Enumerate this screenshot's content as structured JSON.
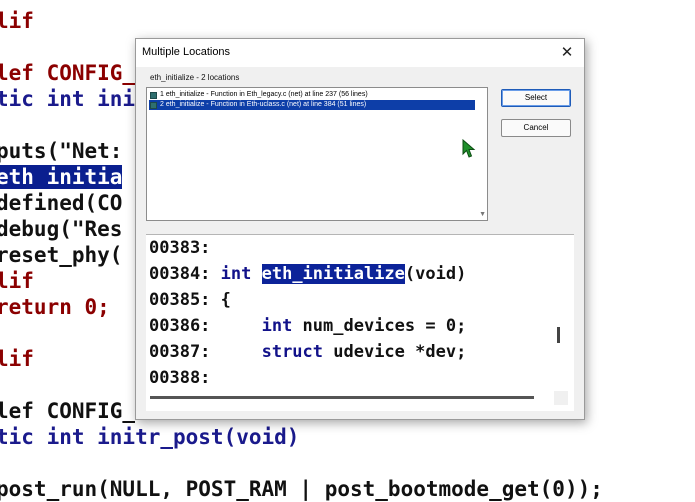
{
  "background_code": [
    {
      "segments": [
        {
          "t": "lif",
          "c": "kw-pre"
        }
      ]
    },
    {
      "segments": []
    },
    {
      "segments": [
        {
          "t": "lef CONFIG_",
          "c": "kw-pre"
        }
      ]
    },
    {
      "segments": [
        {
          "t": "tic int ini",
          "c": "kw-type"
        }
      ]
    },
    {
      "segments": []
    },
    {
      "segments": [
        {
          "t": "puts(\"Net:",
          "c": "plain"
        }
      ]
    },
    {
      "segments": [
        {
          "t": "eth initia",
          "c": "sel"
        }
      ]
    },
    {
      "segments": [
        {
          "t": "defined(CO",
          "c": "plain"
        }
      ]
    },
    {
      "segments": [
        {
          "t": "debug(\"Res",
          "c": "plain"
        }
      ]
    },
    {
      "segments": [
        {
          "t": "reset_phy(",
          "c": "plain"
        }
      ]
    },
    {
      "segments": [
        {
          "t": "lif",
          "c": "kw-pre"
        }
      ]
    },
    {
      "segments": [
        {
          "t": "return 0;",
          "c": "kw-pre"
        }
      ]
    },
    {
      "segments": []
    },
    {
      "segments": [
        {
          "t": "lif",
          "c": "kw-pre"
        }
      ]
    },
    {
      "segments": []
    },
    {
      "segments": [
        {
          "t": "lef CONFIG_",
          "c": "plain"
        }
      ]
    },
    {
      "segments": [
        {
          "t": "tic int initr_post(void)",
          "c": "kw-type"
        }
      ]
    },
    {
      "segments": []
    },
    {
      "segments": [
        {
          "t": "post_run(NULL, POST_RAM | post_bootmode_get(0));",
          "c": "plain"
        }
      ]
    }
  ],
  "dialog": {
    "title": "Multiple Locations",
    "subtitle": "eth_initialize - 2 locations",
    "items": [
      {
        "label": "1 eth_initialize - Function in Eth_legacy.c (net) at line 237 (56 lines)",
        "selected": false
      },
      {
        "label": "2 eth_initialize - Function in Eth-uclass.c (net) at line 384 (51 lines)",
        "selected": true
      }
    ],
    "select_label": "Select",
    "cancel_label": "Cancel",
    "close_glyph": "✕"
  },
  "preview": [
    {
      "ln": "00383:",
      "code": []
    },
    {
      "ln": "00384:",
      "code": [
        {
          "t": " int ",
          "c": "kw"
        },
        {
          "t": "eth_initialize",
          "c": "fn-sel"
        },
        {
          "t": "(void)",
          "c": ""
        }
      ]
    },
    {
      "ln": "00385:",
      "code": [
        {
          "t": " {",
          "c": ""
        }
      ]
    },
    {
      "ln": "00386:",
      "code": [
        {
          "t": "     int ",
          "c": "kw"
        },
        {
          "t": "num_devices = 0;",
          "c": ""
        }
      ]
    },
    {
      "ln": "00387:",
      "code": [
        {
          "t": "     struct ",
          "c": "kw"
        },
        {
          "t": "udevice *dev;",
          "c": ""
        }
      ]
    },
    {
      "ln": "00388:",
      "code": []
    }
  ],
  "colors": {
    "accent": "#0d3ea8",
    "selection": "#0c2399",
    "preprocessor": "#8b0000"
  }
}
